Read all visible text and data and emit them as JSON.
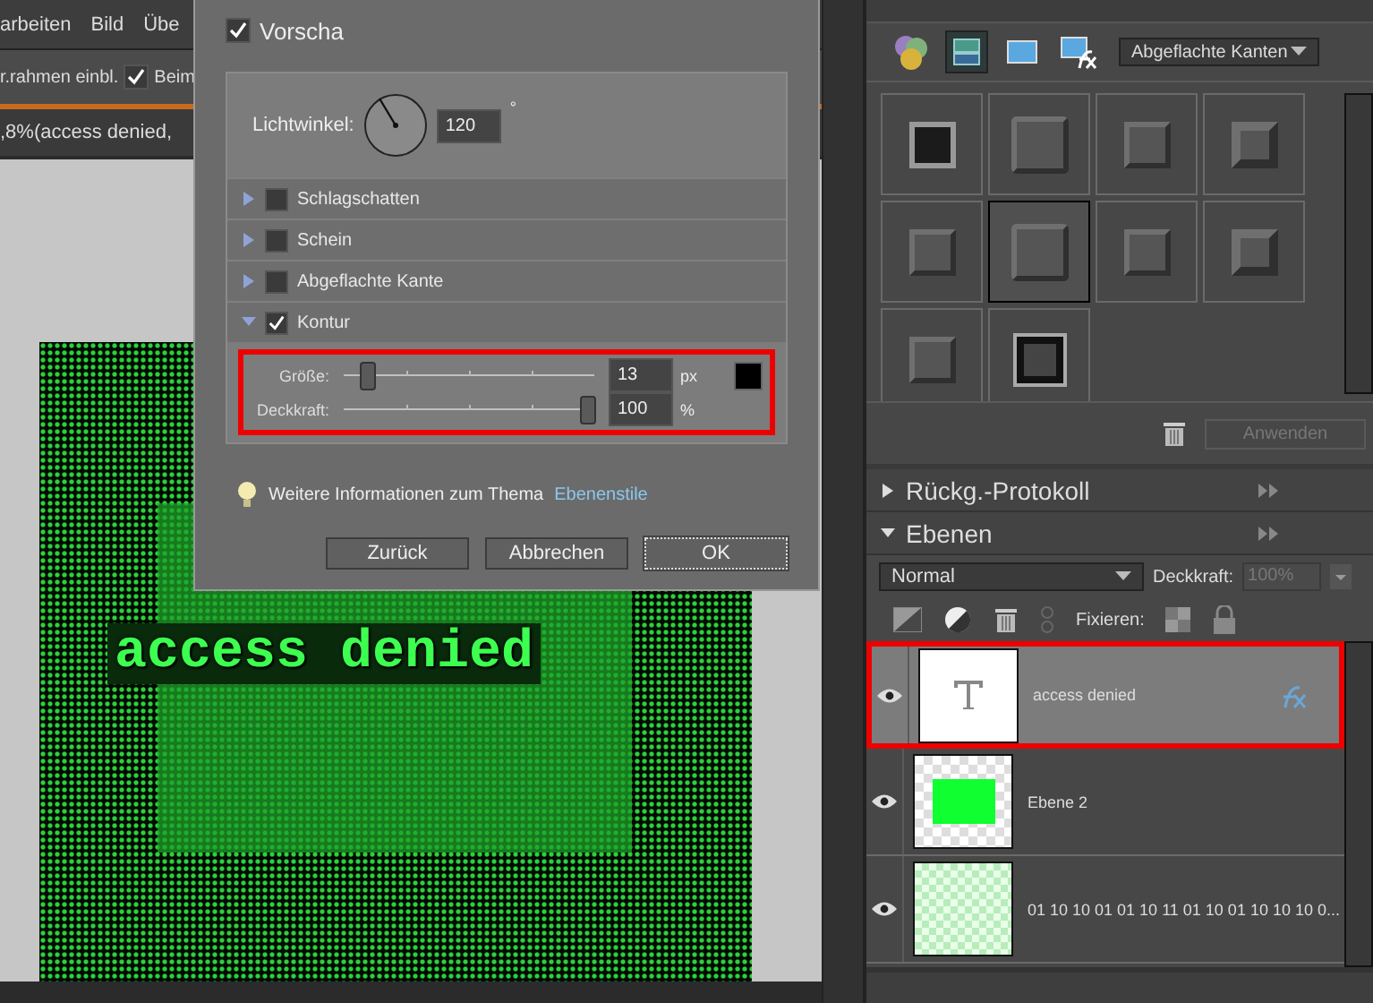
{
  "menu": [
    {
      "label": "arbeiten"
    },
    {
      "label": "Bild"
    },
    {
      "label": "Übe"
    }
  ],
  "options_bar": {
    "label": "r.rahmen einbl.",
    "checkbox": {
      "label": "Beim",
      "checked": true
    }
  },
  "document_tab": {
    "title": ",8%(access denied,"
  },
  "canvas": {
    "text": "access denied"
  },
  "dialog": {
    "preview": {
      "label": "Vorscha",
      "checked": true
    },
    "angle": {
      "label": "Lichtwinkel:",
      "value": "120",
      "unit": "°"
    },
    "sections": [
      {
        "label": "Schlagschatten",
        "checked": false,
        "expanded": false
      },
      {
        "label": "Schein",
        "checked": false,
        "expanded": false
      },
      {
        "label": "Abgeflachte Kante",
        "checked": false,
        "expanded": false
      },
      {
        "label": "Kontur",
        "checked": true,
        "expanded": true
      }
    ],
    "sliders": [
      {
        "label": "Größe:",
        "level": 0.1,
        "value": "13",
        "unit": "px"
      },
      {
        "label": "Deckkraft:",
        "level": 0.98,
        "value": "100",
        "unit": "%"
      }
    ],
    "info": {
      "text": "Weitere Informationen zum Thema",
      "link": "Ebenenstile"
    },
    "buttons": [
      {
        "label": "Zurück",
        "default": false
      },
      {
        "label": "Abbrechen",
        "default": false
      },
      {
        "label": "OK",
        "default": true
      }
    ]
  },
  "effects": {
    "category": "Abgeflachte Kanten",
    "thumbnails": [
      {
        "kind": "photo",
        "selected": false
      },
      {
        "kind": "bevel",
        "selected": false
      },
      {
        "kind": "bevel",
        "selected": false
      },
      {
        "kind": "bevel",
        "selected": false
      },
      {
        "kind": "bevel",
        "selected": false
      },
      {
        "kind": "bevel",
        "selected": true
      },
      {
        "kind": "bevel",
        "selected": false
      },
      {
        "kind": "bevel",
        "selected": false
      },
      {
        "kind": "bevel",
        "selected": false
      },
      {
        "kind": "frame",
        "selected": false
      }
    ],
    "apply": {
      "label": "Anwenden",
      "disabled": true
    }
  },
  "panels": [
    {
      "title": "Rückg.-Protokoll",
      "expanded": false
    },
    {
      "title": "Ebenen",
      "expanded": true
    }
  ],
  "layers": {
    "blend_mode": "Normal",
    "opacity_label": "Deckkraft:",
    "opacity": "100%",
    "opacity_disabled": true,
    "lock_label": "Fixieren:",
    "items": [
      {
        "name": "access denied",
        "kind": "text",
        "selected": true,
        "effects": true,
        "visible": true
      },
      {
        "name": "Ebene 2",
        "kind": "fill",
        "selected": false,
        "effects": false,
        "visible": true
      },
      {
        "name": "01 10 10 01 01 10 11 01 10 01 10 10 10 0...",
        "kind": "pattern",
        "selected": false,
        "effects": false,
        "visible": true
      }
    ]
  }
}
